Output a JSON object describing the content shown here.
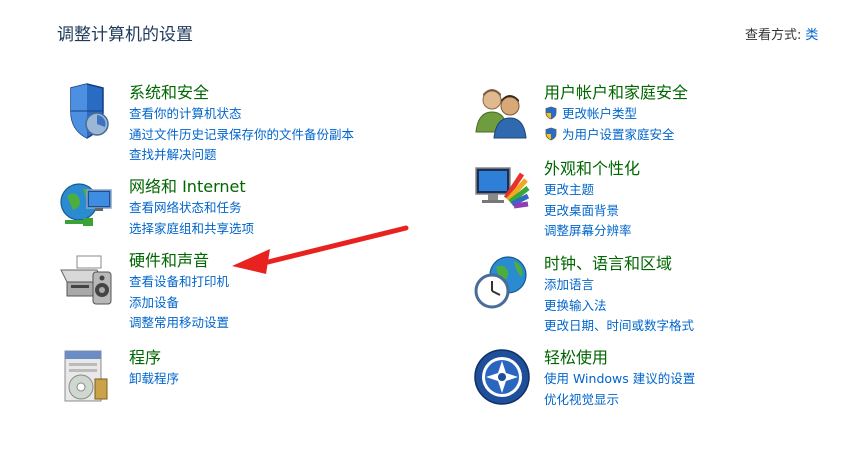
{
  "page": {
    "title": "调整计算机的设置"
  },
  "view_by": {
    "label": "查看方式:",
    "value": "类"
  },
  "categories": [
    {
      "title": "系统和安全",
      "icon": "shield-icon",
      "links": [
        "查看你的计算机状态",
        "通过文件历史记录保存你的文件备份副本",
        "查找并解决问题"
      ]
    },
    {
      "title": "网络和 Internet",
      "icon": "network-globe-icon",
      "links": [
        "查看网络状态和任务",
        "选择家庭组和共享选项"
      ]
    },
    {
      "title": "硬件和声音",
      "icon": "printer-speaker-icon",
      "links": [
        "查看设备和打印机",
        "添加设备",
        "调整常用移动设置"
      ]
    },
    {
      "title": "程序",
      "icon": "programs-icon",
      "links": [
        "卸载程序"
      ]
    },
    {
      "title": "用户帐户和家庭安全",
      "icon": "users-icon",
      "links": [
        "更改帐户类型",
        "为用户设置家庭安全"
      ]
    },
    {
      "title": "外观和个性化",
      "icon": "monitor-palette-icon",
      "links": [
        "更改主题",
        "更改桌面背景",
        "调整屏幕分辨率"
      ]
    },
    {
      "title": "时钟、语言和区域",
      "icon": "clock-globe-icon",
      "links": [
        "添加语言",
        "更换输入法",
        "更改日期、时间或数字格式"
      ]
    },
    {
      "title": "轻松使用",
      "icon": "ease-of-access-icon",
      "links": [
        "使用 Windows 建议的设置",
        "优化视觉显示"
      ]
    }
  ],
  "colors": {
    "title_green": "#006600",
    "link_blue": "#0066cc",
    "heading": "#1e395b",
    "annotation_arrow": "#e8231f"
  }
}
